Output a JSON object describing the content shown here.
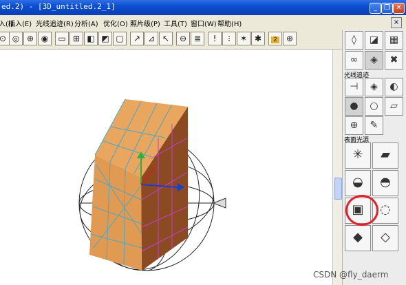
{
  "titlebar": {
    "title": "ed.2) - [3D_untitled.2_1]"
  },
  "window_controls": {
    "minimize": "_",
    "restore": "❐",
    "close": "✕"
  },
  "menu": {
    "items": [
      "入(I)",
      "插入(E)",
      "光线追迹(R)",
      "分析(A)",
      "优化(O)",
      "照片级(P)",
      "工具(T)",
      "窗口(W)",
      "帮助(H)"
    ],
    "close_glyph": "×"
  },
  "toolbar": {
    "buttons": [
      "zoom-icon",
      "zoom-window-icon",
      "pan-icon",
      "zoom-fit-icon",
      "single-view-icon",
      "two-view-icon",
      "cube-front-icon",
      "cube-iso-icon",
      "box-outline-icon",
      "cube-wire-icon",
      "axes-icon",
      "perspective-icon",
      "trim-icon",
      "pointer-icon",
      "lens-grid-icon",
      "list-icon",
      "info-icon",
      "insert-icon",
      "scatter-icon",
      "bug-icon",
      "counter-icon",
      "ray-icon"
    ],
    "counter_label": "2"
  },
  "panel": {
    "ray_trace_label": "光线追迹",
    "surface_source_label": "表面光源"
  },
  "watermark": "CSDN @fly_daerm",
  "colors": {
    "accent": "#e5202b",
    "box_face": "#e09a52",
    "mesh": "#4aa8c8"
  }
}
